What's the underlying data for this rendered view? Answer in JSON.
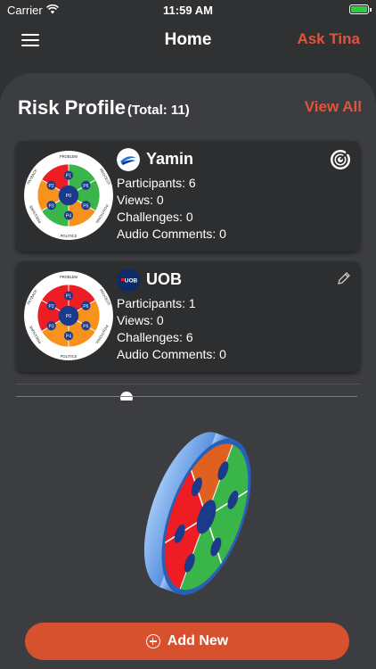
{
  "status_bar": {
    "carrier": "Carrier",
    "time": "11:59 AM"
  },
  "header": {
    "title": "Home",
    "ask_label": "Ask Tina"
  },
  "risk_profile": {
    "title": "Risk Profile",
    "total": "(Total: 11)",
    "view_all": "View All"
  },
  "wheel_labels": {
    "top": "PROBLEM",
    "right_top": "PROCESS",
    "right_bottom": "POSITIONAL",
    "bottom": "POLITICS",
    "left_bottom": "PRESSURE",
    "left_top": "PAYBACK"
  },
  "cards": [
    {
      "name": "Yamin",
      "participants": "Participants: 6",
      "views": "Views: 0",
      "challenges": "Challenges: 0",
      "audio_comments": "Audio Comments: 0",
      "icon": "target-icon",
      "segments": {
        "P1": "#ee1c23",
        "P2": "#f7931d",
        "P3": "#3ab54a",
        "P4": "#f7931d",
        "P5": "#3ab54a",
        "P6": "#3ab54a"
      }
    },
    {
      "name": "UOB",
      "logo_text": "UOB",
      "participants": "Participants: 1",
      "views": "Views: 0",
      "challenges": "Challenges: 6",
      "audio_comments": "Audio Comments: 0",
      "icon": "pencil-icon",
      "segments": {
        "P1": "#ee1c23",
        "P2": "#ee1c23",
        "P3": "#f7931d",
        "P4": "#f7931d",
        "P5": "#f7931d",
        "P6": "#ee1c23"
      }
    }
  ],
  "add_button": {
    "label": "Add New"
  },
  "colors": {
    "accent": "#e0553b",
    "background": "#2f3133",
    "panel": "#3b3d40",
    "red": "#ee1c23",
    "orange": "#f7931d",
    "green": "#3ab54a",
    "center": "#1b3a8a"
  }
}
